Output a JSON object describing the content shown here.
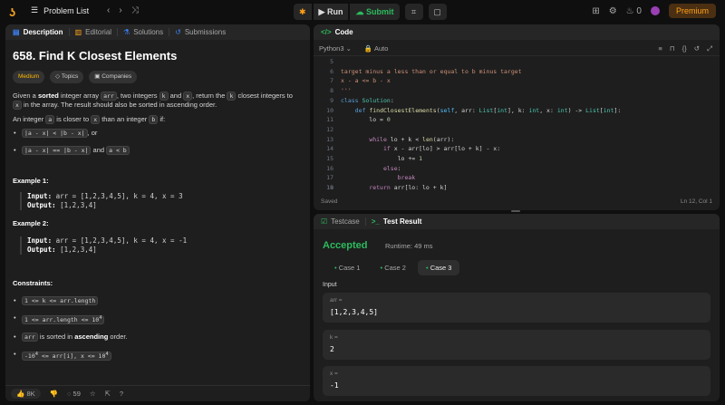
{
  "topbar": {
    "title": "Problem List",
    "run": "Run",
    "submit": "Submit",
    "streak": "0",
    "premium": "Premium"
  },
  "left": {
    "tabs": [
      "Description",
      "Editorial",
      "Solutions",
      "Submissions"
    ],
    "title": "658. Find K Closest Elements",
    "solved": "Solved",
    "tags": [
      "Medium",
      "Topics",
      "Companies"
    ],
    "p1": {
      "a": "Given a ",
      "b": "sorted",
      "c": " integer array ",
      "d": "arr",
      "e": ", two integers ",
      "f": "k",
      "g": " and ",
      "h": "x",
      "i": ", return the ",
      "j": "k",
      "k": " closest integers to ",
      "l": "x",
      "m": " in the array. The result should also be sorted in ascending order."
    },
    "p2": {
      "a": "An integer ",
      "b": "a",
      "c": " is closer to ",
      "d": "x",
      "e": " than an integer ",
      "f": "b",
      "g": " if:"
    },
    "b1": {
      "a": "|a - x| < |b - x|",
      "b": ", or"
    },
    "b2": {
      "a": "|a - x| == |b - x|",
      "b": " and ",
      "c": "a < b"
    },
    "ex1": {
      "h": "Example 1:",
      "il": "Input:",
      "iv": " arr = [1,2,3,4,5], k = 4, x = 3",
      "ol": "Output:",
      "ov": " [1,2,3,4]"
    },
    "ex2": {
      "h": "Example 2:",
      "il": "Input:",
      "iv": " arr = [1,2,3,4,5], k = 4, x = -1",
      "ol": "Output:",
      "ov": " [1,2,3,4]"
    },
    "constraints": "Constraints:",
    "c1": "1 <= k <= arr.length",
    "c2": "1 <= arr.length <= 10",
    "c2s": "4",
    "c3": {
      "a": "arr",
      "b": " is sorted in ",
      "c": "ascending",
      "d": " order."
    },
    "c4a": "-10",
    "c4s1": "4",
    "c4b": " <= arr[i], x <= 10",
    "c4s2": "4",
    "footer": {
      "likes": "8K",
      "comments": "59"
    }
  },
  "code": {
    "tab": "Code",
    "lang": "Python3",
    "auto": "Auto",
    "saved": "Saved",
    "pos": "Ln 12, Col 1"
  },
  "test": {
    "tabs": [
      "Testcase",
      "Test Result"
    ],
    "status": "Accepted",
    "runtime": "Runtime: 49 ms",
    "cases": [
      "Case 1",
      "Case 2",
      "Case 3"
    ],
    "input_label": "Input",
    "inputs": [
      {
        "k": "arr =",
        "v": "[1,2,3,4,5]"
      },
      {
        "k": "k =",
        "v": "2"
      },
      {
        "k": "x =",
        "v": "-1"
      }
    ]
  }
}
